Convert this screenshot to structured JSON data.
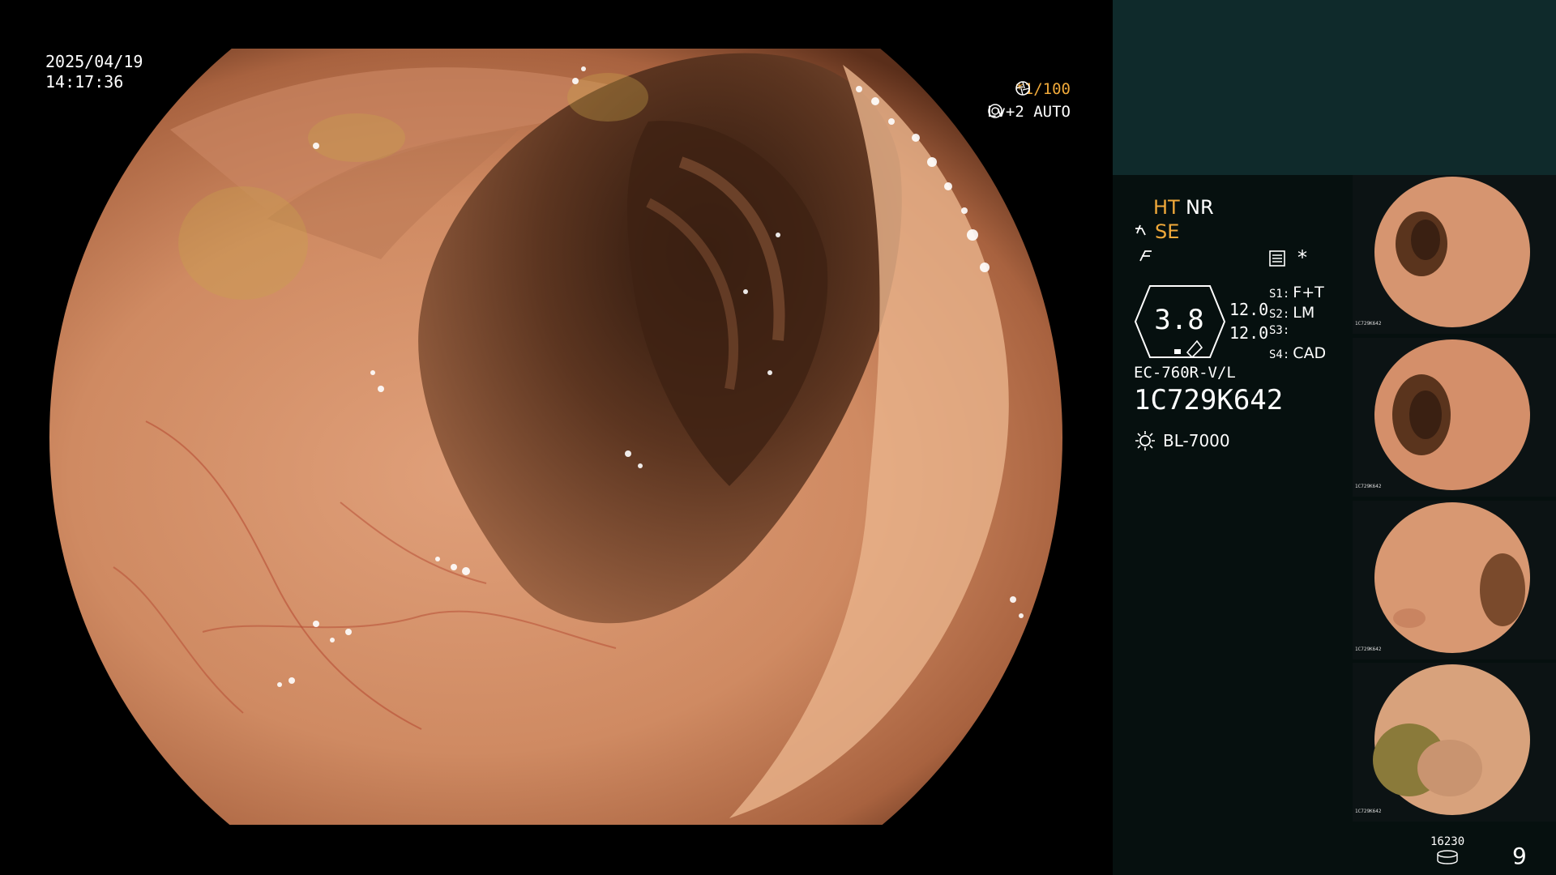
{
  "overlay": {
    "date": "2025/04/19",
    "time": "14:17:36",
    "shutter": "*1/100",
    "iris": "Lv+2 AUTO"
  },
  "panel": {
    "ht_label": "HT",
    "nr_label": "NR",
    "se_label": "SE",
    "star": "*",
    "zoom_value": "3.8",
    "value_a": "12.0",
    "value_b": "12.0",
    "switches": [
      {
        "key": "S1:",
        "value": "F+T"
      },
      {
        "key": "S2:",
        "value": "LM"
      },
      {
        "key": "S3:",
        "value": ""
      },
      {
        "key": "S4:",
        "value": "CAD"
      }
    ],
    "scope_model": "EC-760R-V/L",
    "serial_number": "1C729K642",
    "light_source": "BL-7000",
    "image_count": "16230",
    "page_number": "9"
  },
  "thumbnails": [
    {
      "id": "1C729K642"
    },
    {
      "id": "1C729K642"
    },
    {
      "id": "1C729K642"
    },
    {
      "id": "1C729K642"
    }
  ],
  "colors": {
    "accent_orange": "#f0a93a",
    "panel_top": "#0f2a2b",
    "panel_body": "#06100f",
    "mucosa": "#d99068"
  },
  "icons": {
    "shutter": "shutter-icon",
    "iris": "iris-icon",
    "structure": "structure-enhance-icon",
    "freeze": "freeze-icon",
    "menu": "menu-icon",
    "zoom": "zoom-indicator-icon",
    "light": "light-source-icon",
    "disk": "disk-icon"
  }
}
